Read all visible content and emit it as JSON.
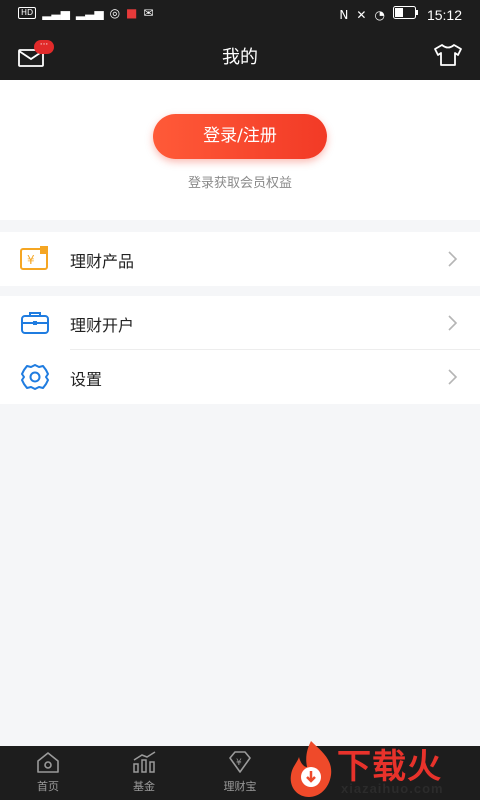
{
  "status_bar": {
    "left_chips": [
      "HD",
      "4G",
      "4G"
    ],
    "time": "15:12",
    "icons": [
      "signal-icon",
      "wifi-icon",
      "notification-icon",
      "wechat-icon",
      "nfc-icon",
      "mute-icon",
      "speed-icon",
      "battery-icon"
    ]
  },
  "header": {
    "title": "我的",
    "mail_badge": "···"
  },
  "login": {
    "button_label": "登录/注册",
    "subtitle": "登录获取会员权益"
  },
  "menu": {
    "group1": [
      {
        "label": "理财产品",
        "icon": "yuan-card-icon"
      }
    ],
    "group2": [
      {
        "label": "理财开户",
        "icon": "briefcase-icon"
      },
      {
        "label": "设置",
        "icon": "gear-icon"
      }
    ]
  },
  "bottom_nav": [
    {
      "label": "首页",
      "icon": "home-icon"
    },
    {
      "label": "基金",
      "icon": "chart-icon"
    },
    {
      "label": "理财宝",
      "icon": "diamond-yuan-icon"
    }
  ],
  "watermark": {
    "text": "下载火",
    "url": "xiazaihuo.com"
  },
  "colors": {
    "accent": "#f23a26",
    "dark": "#1d1d1d",
    "icon_blue": "#1f7ce0",
    "icon_orange": "#f5a623"
  }
}
